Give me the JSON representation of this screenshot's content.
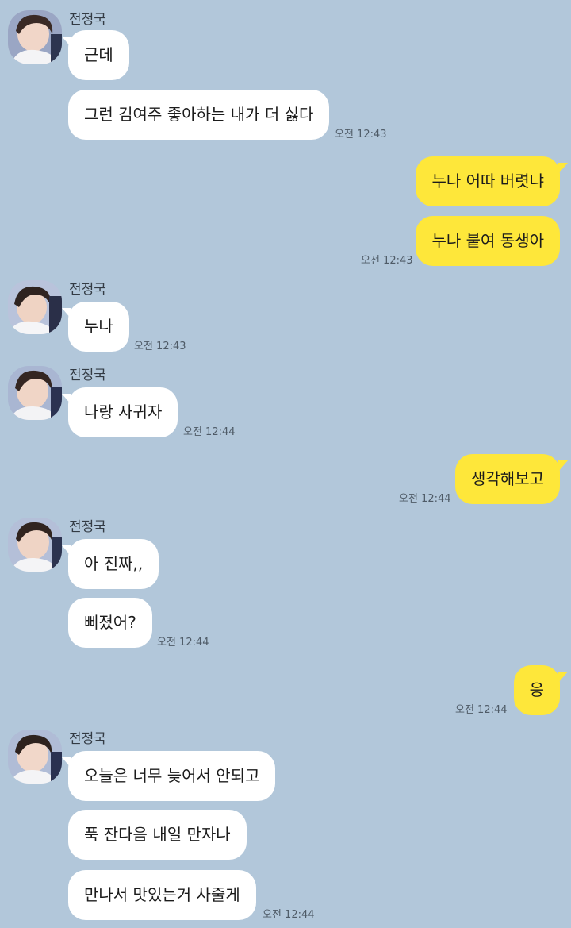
{
  "colors": {
    "background": "#b2c7da",
    "incoming_bubble": "#ffffff",
    "outgoing_bubble": "#fee73a"
  },
  "sender_name": "전정국",
  "avatar_icon": "profile-photo-avatar",
  "messages": [
    {
      "from": "them",
      "text": "근데"
    },
    {
      "from": "them",
      "text": "그런 김여주 좋아하는 내가 더 싫다",
      "time": "오전 12:43"
    },
    {
      "from": "me",
      "text": "누나 어따 버렷냐"
    },
    {
      "from": "me",
      "text": "누나 붙여 동생아",
      "time": "오전 12:43"
    },
    {
      "from": "them",
      "text": "누나",
      "time": "오전 12:43"
    },
    {
      "from": "them",
      "text": "나랑 사귀자",
      "time": "오전 12:44"
    },
    {
      "from": "me",
      "text": "생각해보고",
      "time": "오전 12:44"
    },
    {
      "from": "them",
      "text": "아 진짜,,"
    },
    {
      "from": "them",
      "text": "삐졌어?",
      "time": "오전 12:44"
    },
    {
      "from": "me",
      "text": "응",
      "time": "오전 12:44"
    },
    {
      "from": "them",
      "text": "오늘은 너무 늦어서 안되고"
    },
    {
      "from": "them",
      "text": "푹 잔다음 내일 만자나"
    },
    {
      "from": "them",
      "text": "만나서 맛있는거 사줄게",
      "time": "오전 12:44"
    }
  ]
}
